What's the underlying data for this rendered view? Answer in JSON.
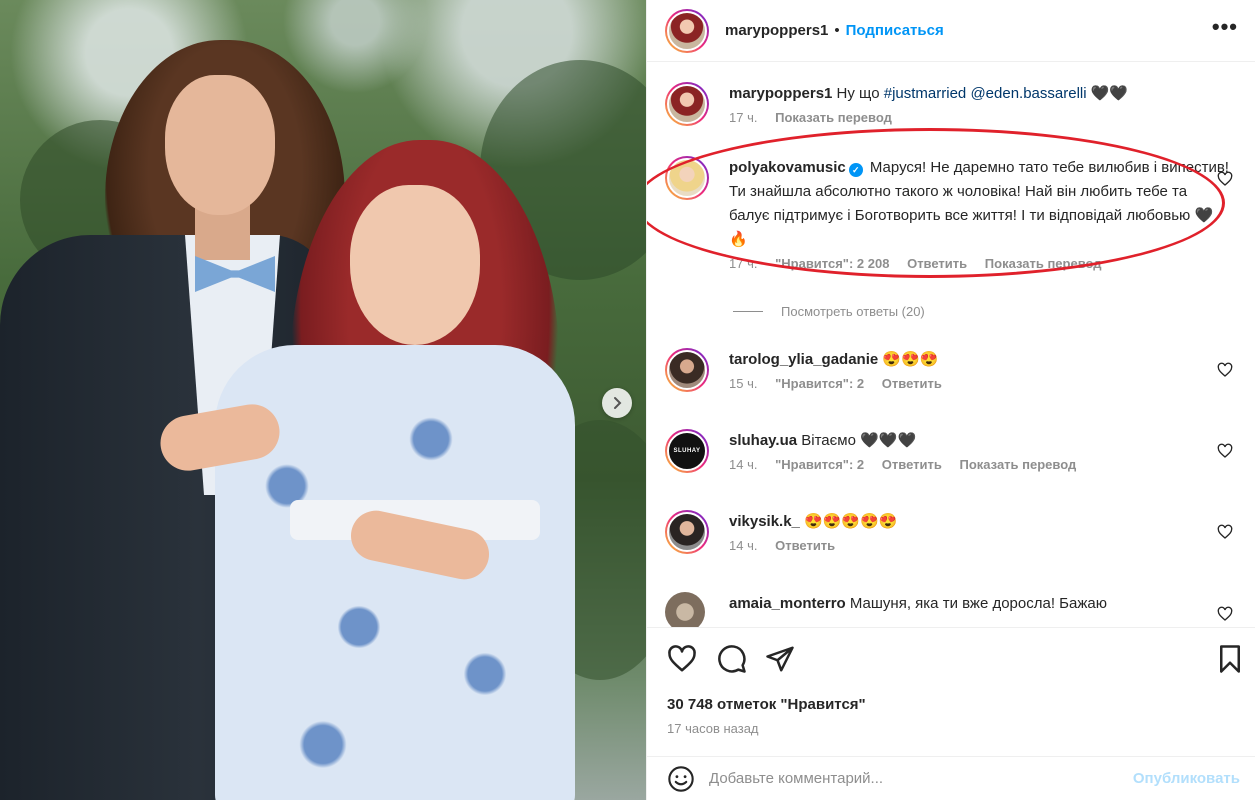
{
  "post": {
    "author": "marypoppers1",
    "follow_label": "Подписаться",
    "dot": "•",
    "more_label": "•••"
  },
  "caption": {
    "user": "marypoppers1",
    "text_prefix": "Ну що",
    "hashtag": "#justmarried",
    "mention": "@eden.bassarelli",
    "emoji": "🖤🖤",
    "time": "17 ч.",
    "translate": "Показать перевод"
  },
  "comments": [
    {
      "user": "polyakovamusic",
      "verified": true,
      "text": "Маруся! Не даремно тато тебе вилюбив і випестив! Ти знайшла абсолютно такого ж чоловіка! Най він любить тебе та балує підтримує і Боготворить все життя! І ти відповідай любовью 🖤🔥",
      "time": "17 ч.",
      "likes": "\"Нравится\": 2 208",
      "reply": "Ответить",
      "translate": "Показать перевод",
      "view_replies": "Посмотреть ответы (20)"
    },
    {
      "user": "tarolog_ylia_gadanie",
      "text": "😍😍😍",
      "time": "15 ч.",
      "likes": "\"Нравится\": 2",
      "reply": "Ответить"
    },
    {
      "user": "sluhay.ua",
      "avatar_text": "SLUHAY",
      "text": "Вітаємо 🖤🖤🖤",
      "time": "14 ч.",
      "likes": "\"Нравится\": 2",
      "reply": "Ответить",
      "translate": "Показать перевод"
    },
    {
      "user": "vikysik.k_",
      "text": "😍😍😍😍😍",
      "time": "14 ч.",
      "reply": "Ответить"
    },
    {
      "user": "amaia_monterro",
      "text": "Машуня, яка ти вже доросла! Бажаю"
    }
  ],
  "stats": {
    "likes": "30 748 отметок \"Нравится\"",
    "time_ago": "17 часов назад"
  },
  "add_comment": {
    "placeholder": "Добавьте комментарий...",
    "publish": "Опубликовать"
  },
  "colors": {
    "accent": "#0095f6",
    "highlight": "#e0212b"
  }
}
